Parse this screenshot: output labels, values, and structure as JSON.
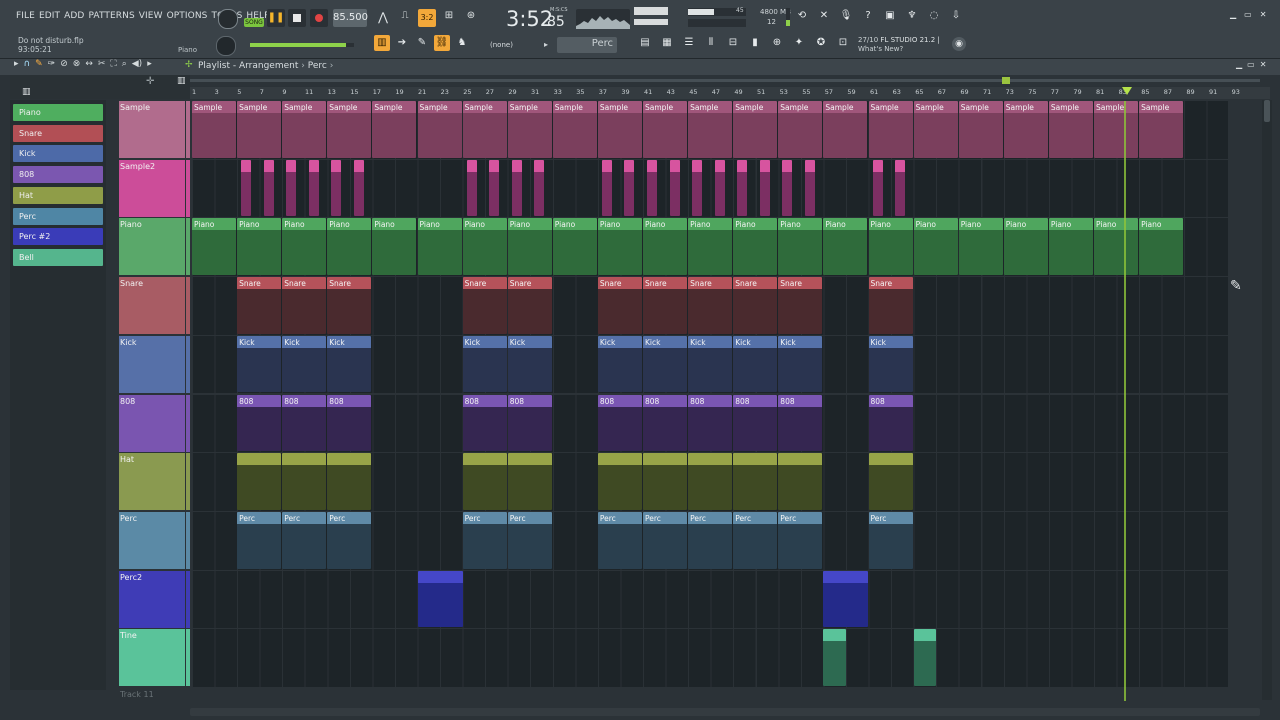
{
  "menu": [
    "FILE",
    "EDIT",
    "ADD",
    "PATTERNS",
    "VIEW",
    "OPTIONS",
    "TOOLS",
    "HELP"
  ],
  "transport": {
    "song_label": "SONG",
    "tempo": "85.500",
    "time": "3:52",
    "time_fraction": "85",
    "time_unit": "M:S:CS",
    "cpu_label": "45",
    "memory": "4800 MB",
    "memory_sub": "12"
  },
  "hint": {
    "line1": "Do not disturb.flp",
    "line2": "93:05:21",
    "piano_label": "Piano"
  },
  "toolbar": {
    "pattern_selector": "(none)",
    "current_pattern": "Perc",
    "news_date": "27/10",
    "news_title": "FL STUDIO 21.2 |",
    "news_sub": "What's New?"
  },
  "playlist": {
    "title": "Playlist - Arrangement",
    "breadcrumb": "Perc"
  },
  "ruler_marks": [
    "1",
    "3",
    "5",
    "7",
    "9",
    "11",
    "13",
    "15",
    "17",
    "19",
    "21",
    "23",
    "25",
    "27",
    "29",
    "31",
    "33",
    "35",
    "37",
    "39",
    "41",
    "43",
    "45",
    "47",
    "49",
    "51",
    "53",
    "55",
    "57",
    "59",
    "61",
    "63",
    "65",
    "67",
    "69",
    "71",
    "73",
    "75",
    "77",
    "79",
    "81",
    "83",
    "85",
    "87",
    "89",
    "91",
    "93"
  ],
  "patterns": [
    {
      "label": "Piano",
      "color": "#4fae5f"
    },
    {
      "label": "Snare",
      "color": "#b24f55"
    },
    {
      "label": "Kick",
      "color": "#4d6aa8"
    },
    {
      "label": "808",
      "color": "#7b57b0"
    },
    {
      "label": "Hat",
      "color": "#8f9d48"
    },
    {
      "label": "Perc",
      "color": "#4f86a5"
    },
    {
      "label": "Perc #2",
      "color": "#3a3cb8"
    },
    {
      "label": "Bell",
      "color": "#55b58d"
    }
  ],
  "tracks": [
    {
      "label": "Sample",
      "color": "#b16c8d",
      "clipLabel": "Sample"
    },
    {
      "label": "Sample2",
      "color": "#cc4d99",
      "clipLabel": ""
    },
    {
      "label": "Piano",
      "color": "#5aa86a",
      "clipLabel": "Piano"
    },
    {
      "label": "Snare",
      "color": "#a85c64",
      "clipLabel": "Snare"
    },
    {
      "label": "Kick",
      "color": "#5670a8",
      "clipLabel": "Kick"
    },
    {
      "label": "808",
      "color": "#7a55b0",
      "clipLabel": "808"
    },
    {
      "label": "Hat",
      "color": "#8a9a50",
      "clipLabel": ""
    },
    {
      "label": "Perc",
      "color": "#5b8aa6",
      "clipLabel": "Perc"
    },
    {
      "label": "Perc2",
      "color": "#3f3cb6",
      "clipLabel": ""
    },
    {
      "label": "Tine",
      "color": "#5ac39a",
      "clipLabel": ""
    }
  ],
  "empty_track": "Track 11"
}
